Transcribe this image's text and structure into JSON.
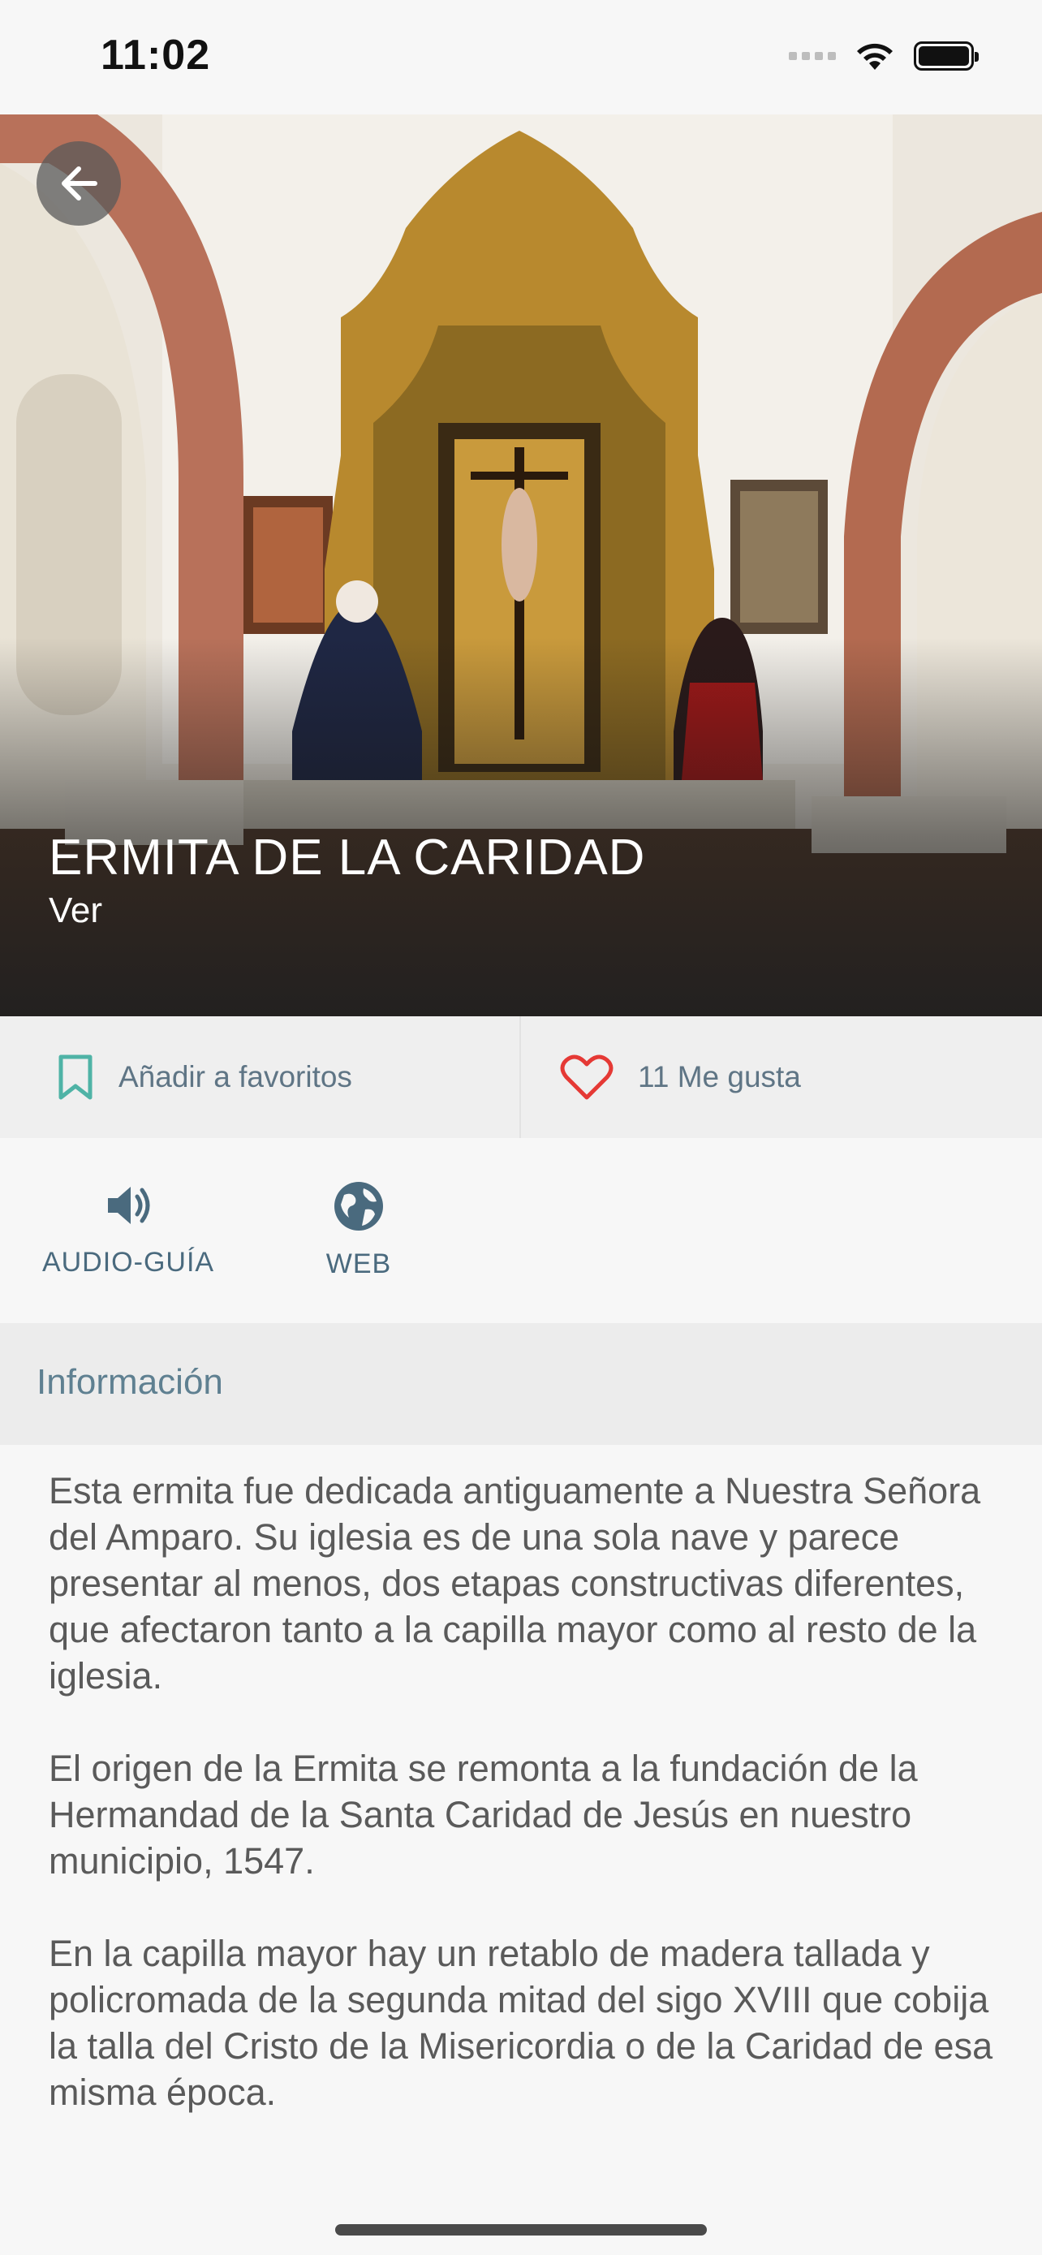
{
  "status_bar": {
    "time": "11:02"
  },
  "hero": {
    "title": "ERMITA DE LA CARIDAD",
    "subtitle": "Ver",
    "back_icon": "arrow-left-icon"
  },
  "actions": {
    "favorites_label": "Añadir a favoritos",
    "favorites_icon": "bookmark-icon",
    "likes_label": "11 Me gusta",
    "likes_icon": "heart-icon"
  },
  "resources": [
    {
      "label": "AUDIO-GUÍA",
      "icon": "speaker-icon"
    },
    {
      "label": "WEB",
      "icon": "globe-icon"
    }
  ],
  "info": {
    "title": "Información",
    "paragraphs": [
      "Esta ermita fue dedicada antiguamente a Nuestra Señora del Amparo. Su iglesia es de una sola nave y parece presentar al menos, dos etapas constructivas diferentes, que afectaron tanto a la capilla mayor como al resto de la iglesia.",
      "El origen de la Ermita se remonta a la fundación de la Hermandad de la Santa Caridad de Jesús en nuestro municipio, 1547.",
      "En la capilla mayor hay un retablo de madera tallada y policromada de la segunda mitad del sigo XVIII que cobija la talla del Cristo de la Misericordia o de la Caridad de esa misma época."
    ]
  },
  "colors": {
    "accent_teal": "#4fb3a6",
    "heart_red": "#e53935",
    "label_blue_gray": "#5f7585"
  }
}
